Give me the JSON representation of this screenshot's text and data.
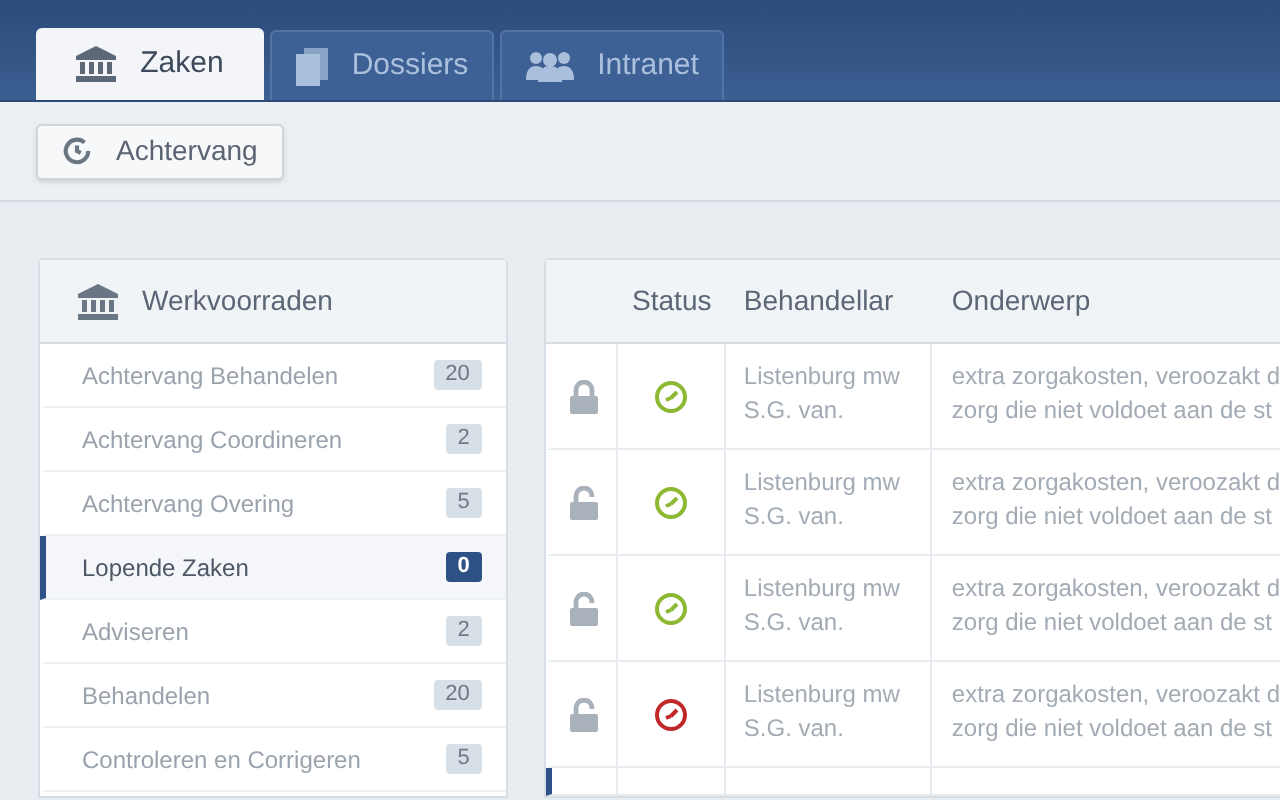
{
  "tabs": [
    {
      "label": "Zaken",
      "selected": true
    },
    {
      "label": "Dossiers",
      "selected": false
    },
    {
      "label": "Intranet",
      "selected": false
    }
  ],
  "toolbar": {
    "button": "Achtervang"
  },
  "sidebar": {
    "title": "Werkvoorraden",
    "items": [
      {
        "label": "Achtervang Behandelen",
        "count": "20",
        "selected": false
      },
      {
        "label": "Achtervang Coordineren",
        "count": "2",
        "selected": false
      },
      {
        "label": "Achtervang Overing",
        "count": "5",
        "selected": false
      },
      {
        "label": "Lopende Zaken",
        "count": "0",
        "selected": true
      },
      {
        "label": "Adviseren",
        "count": "2",
        "selected": false
      },
      {
        "label": "Behandelen",
        "count": "20",
        "selected": false
      },
      {
        "label": "Controleren en Corrigeren",
        "count": "5",
        "selected": false
      }
    ]
  },
  "table": {
    "columns": [
      "Status",
      "Behandellar",
      "Onderwerp"
    ],
    "rows": [
      {
        "locked": true,
        "color": "#8cb832",
        "behandelaar": [
          "Listenburg mw",
          "S.G. van."
        ],
        "onderwerp": [
          "extra zorgakosten, veroozakt d",
          "zorg die niet voldoet aan de st"
        ],
        "selected": false
      },
      {
        "locked": false,
        "color": "#8cb832",
        "behandelaar": [
          "Listenburg mw",
          "S.G. van."
        ],
        "onderwerp": [
          "extra zorgakosten, veroozakt d",
          "zorg die niet voldoet aan de st"
        ],
        "selected": false
      },
      {
        "locked": false,
        "color": "#8cb832",
        "behandelaar": [
          "Listenburg mw",
          "S.G. van."
        ],
        "onderwerp": [
          "extra zorgakosten, veroozakt d",
          "zorg die niet voldoet aan de st"
        ],
        "selected": false
      },
      {
        "locked": false,
        "color": "#c0282a",
        "behandelaar": [
          "Listenburg mw",
          "S.G. van."
        ],
        "onderwerp": [
          "extra zorgakosten, veroozakt d",
          "zorg die niet voldoet aan de st"
        ],
        "selected": false
      },
      {
        "selected": true
      }
    ]
  }
}
